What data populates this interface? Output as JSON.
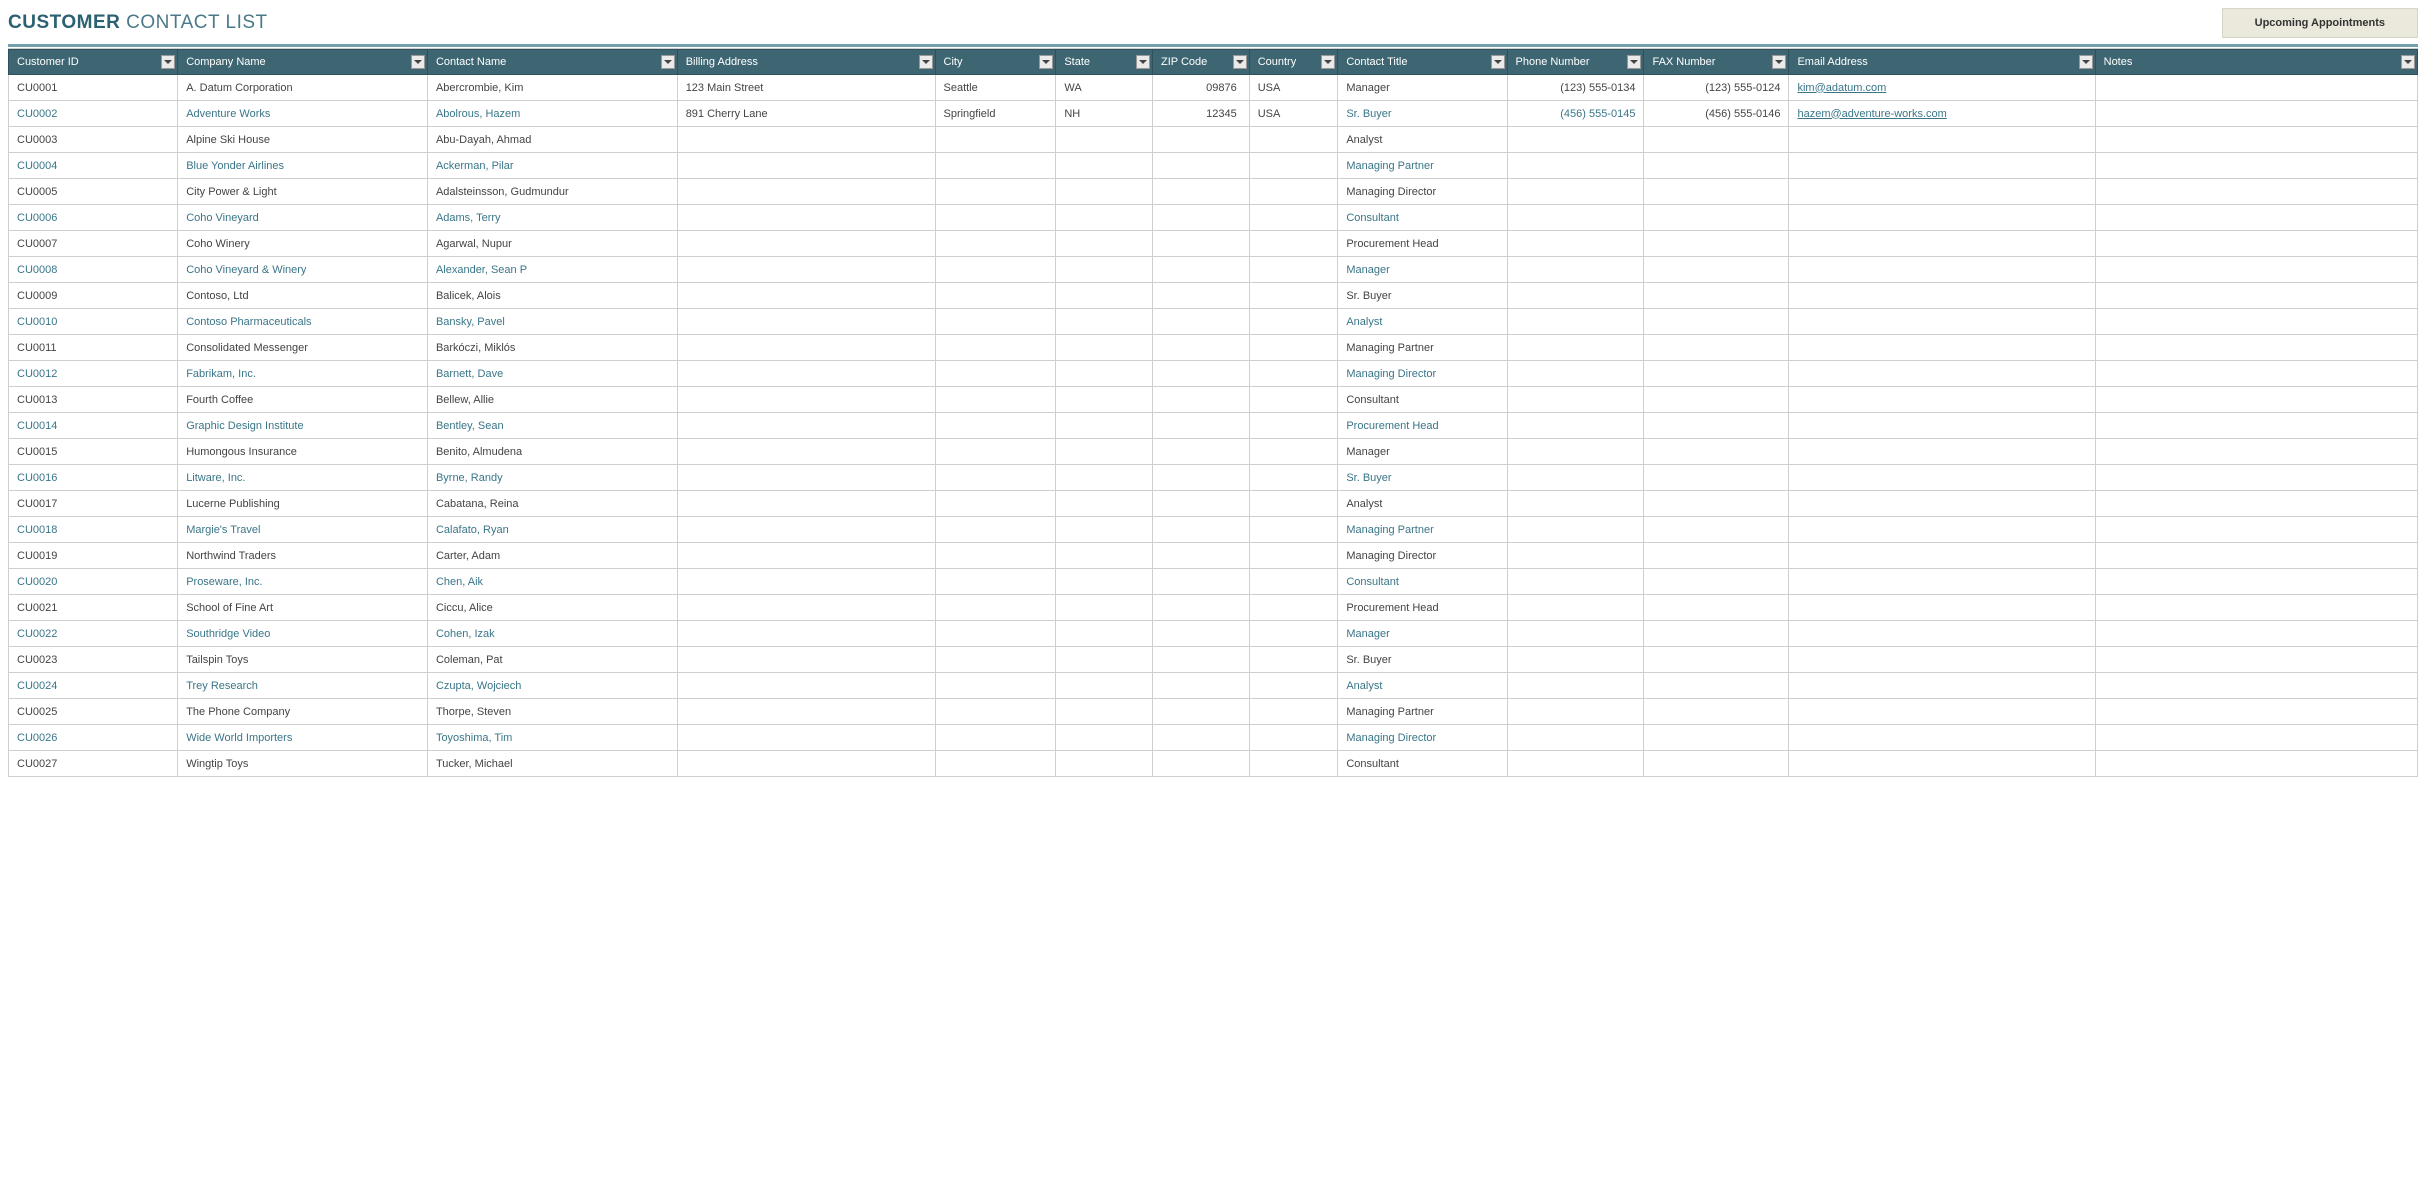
{
  "title": {
    "bold": "CUSTOMER",
    "rest": " CONTACT LIST"
  },
  "appointments_button": "Upcoming Appointments",
  "columns": [
    "Customer ID",
    "Company Name",
    "Contact Name",
    "Billing Address",
    "City",
    "State",
    "ZIP Code",
    "Country",
    "Contact Title",
    "Phone Number",
    "FAX Number",
    "Email Address",
    "Notes"
  ],
  "rows": [
    {
      "id": "CU0001",
      "company": "A. Datum Corporation",
      "contact": "Abercrombie, Kim",
      "billing": "123 Main Street",
      "city": "Seattle",
      "state": "WA",
      "zip": "09876",
      "country": "USA",
      "title": "Manager",
      "phone": "(123) 555-0134",
      "fax": "(123) 555-0124",
      "email": "kim@adatum.com",
      "notes": "",
      "linked": false
    },
    {
      "id": "CU0002",
      "company": "Adventure Works",
      "contact": "Abolrous, Hazem",
      "billing": "891 Cherry Lane",
      "city": "Springfield",
      "state": "NH",
      "zip": "12345",
      "country": "USA",
      "title": "Sr. Buyer",
      "phone": "(456) 555-0145",
      "fax": "(456) 555-0146",
      "email": "hazem@adventure-works.com",
      "notes": "",
      "linked": true
    },
    {
      "id": "CU0003",
      "company": "Alpine Ski House",
      "contact": "Abu-Dayah, Ahmad",
      "billing": "",
      "city": "",
      "state": "",
      "zip": "",
      "country": "",
      "title": "Analyst",
      "phone": "",
      "fax": "",
      "email": "",
      "notes": "",
      "linked": false
    },
    {
      "id": "CU0004",
      "company": "Blue Yonder Airlines",
      "contact": "Ackerman, Pilar",
      "billing": "",
      "city": "",
      "state": "",
      "zip": "",
      "country": "",
      "title": "Managing Partner",
      "phone": "",
      "fax": "",
      "email": "",
      "notes": "",
      "linked": true
    },
    {
      "id": "CU0005",
      "company": "City Power & Light",
      "contact": "Adalsteinsson, Gudmundur",
      "billing": "",
      "city": "",
      "state": "",
      "zip": "",
      "country": "",
      "title": "Managing Director",
      "phone": "",
      "fax": "",
      "email": "",
      "notes": "",
      "linked": false
    },
    {
      "id": "CU0006",
      "company": "Coho Vineyard",
      "contact": "Adams, Terry",
      "billing": "",
      "city": "",
      "state": "",
      "zip": "",
      "country": "",
      "title": "Consultant",
      "phone": "",
      "fax": "",
      "email": "",
      "notes": "",
      "linked": true
    },
    {
      "id": "CU0007",
      "company": "Coho Winery",
      "contact": "Agarwal, Nupur",
      "billing": "",
      "city": "",
      "state": "",
      "zip": "",
      "country": "",
      "title": "Procurement Head",
      "phone": "",
      "fax": "",
      "email": "",
      "notes": "",
      "linked": false
    },
    {
      "id": "CU0008",
      "company": "Coho Vineyard & Winery",
      "contact": "Alexander, Sean P",
      "billing": "",
      "city": "",
      "state": "",
      "zip": "",
      "country": "",
      "title": "Manager",
      "phone": "",
      "fax": "",
      "email": "",
      "notes": "",
      "linked": true
    },
    {
      "id": "CU0009",
      "company": "Contoso, Ltd",
      "contact": "Balicek, Alois",
      "billing": "",
      "city": "",
      "state": "",
      "zip": "",
      "country": "",
      "title": "Sr. Buyer",
      "phone": "",
      "fax": "",
      "email": "",
      "notes": "",
      "linked": false
    },
    {
      "id": "CU0010",
      "company": "Contoso Pharmaceuticals",
      "contact": "Bansky, Pavel",
      "billing": "",
      "city": "",
      "state": "",
      "zip": "",
      "country": "",
      "title": "Analyst",
      "phone": "",
      "fax": "",
      "email": "",
      "notes": "",
      "linked": true
    },
    {
      "id": "CU0011",
      "company": "Consolidated Messenger",
      "contact": "Barkóczi, Miklós",
      "billing": "",
      "city": "",
      "state": "",
      "zip": "",
      "country": "",
      "title": "Managing Partner",
      "phone": "",
      "fax": "",
      "email": "",
      "notes": "",
      "linked": false
    },
    {
      "id": "CU0012",
      "company": "Fabrikam, Inc.",
      "contact": "Barnett, Dave",
      "billing": "",
      "city": "",
      "state": "",
      "zip": "",
      "country": "",
      "title": "Managing Director",
      "phone": "",
      "fax": "",
      "email": "",
      "notes": "",
      "linked": true
    },
    {
      "id": "CU0013",
      "company": "Fourth Coffee",
      "contact": "Bellew, Allie",
      "billing": "",
      "city": "",
      "state": "",
      "zip": "",
      "country": "",
      "title": "Consultant",
      "phone": "",
      "fax": "",
      "email": "",
      "notes": "",
      "linked": false
    },
    {
      "id": "CU0014",
      "company": "Graphic Design Institute",
      "contact": "Bentley, Sean",
      "billing": "",
      "city": "",
      "state": "",
      "zip": "",
      "country": "",
      "title": "Procurement Head",
      "phone": "",
      "fax": "",
      "email": "",
      "notes": "",
      "linked": true
    },
    {
      "id": "CU0015",
      "company": "Humongous Insurance",
      "contact": "Benito, Almudena",
      "billing": "",
      "city": "",
      "state": "",
      "zip": "",
      "country": "",
      "title": "Manager",
      "phone": "",
      "fax": "",
      "email": "",
      "notes": "",
      "linked": false
    },
    {
      "id": "CU0016",
      "company": "Litware, Inc.",
      "contact": "Byrne, Randy",
      "billing": "",
      "city": "",
      "state": "",
      "zip": "",
      "country": "",
      "title": "Sr. Buyer",
      "phone": "",
      "fax": "",
      "email": "",
      "notes": "",
      "linked": true
    },
    {
      "id": "CU0017",
      "company": "Lucerne Publishing",
      "contact": "Cabatana, Reina",
      "billing": "",
      "city": "",
      "state": "",
      "zip": "",
      "country": "",
      "title": "Analyst",
      "phone": "",
      "fax": "",
      "email": "",
      "notes": "",
      "linked": false
    },
    {
      "id": "CU0018",
      "company": "Margie's Travel",
      "contact": "Calafato, Ryan",
      "billing": "",
      "city": "",
      "state": "",
      "zip": "",
      "country": "",
      "title": "Managing Partner",
      "phone": "",
      "fax": "",
      "email": "",
      "notes": "",
      "linked": true
    },
    {
      "id": "CU0019",
      "company": "Northwind Traders",
      "contact": "Carter, Adam",
      "billing": "",
      "city": "",
      "state": "",
      "zip": "",
      "country": "",
      "title": "Managing Director",
      "phone": "",
      "fax": "",
      "email": "",
      "notes": "",
      "linked": false
    },
    {
      "id": "CU0020",
      "company": "Proseware, Inc.",
      "contact": "Chen, Aik",
      "billing": "",
      "city": "",
      "state": "",
      "zip": "",
      "country": "",
      "title": "Consultant",
      "phone": "",
      "fax": "",
      "email": "",
      "notes": "",
      "linked": true
    },
    {
      "id": "CU0021",
      "company": "School of Fine Art",
      "contact": "Ciccu, Alice",
      "billing": "",
      "city": "",
      "state": "",
      "zip": "",
      "country": "",
      "title": "Procurement Head",
      "phone": "",
      "fax": "",
      "email": "",
      "notes": "",
      "linked": false
    },
    {
      "id": "CU0022",
      "company": "Southridge Video",
      "contact": "Cohen, Izak",
      "billing": "",
      "city": "",
      "state": "",
      "zip": "",
      "country": "",
      "title": "Manager",
      "phone": "",
      "fax": "",
      "email": "",
      "notes": "",
      "linked": true
    },
    {
      "id": "CU0023",
      "company": "Tailspin Toys",
      "contact": "Coleman, Pat",
      "billing": "",
      "city": "",
      "state": "",
      "zip": "",
      "country": "",
      "title": "Sr. Buyer",
      "phone": "",
      "fax": "",
      "email": "",
      "notes": "",
      "linked": false
    },
    {
      "id": "CU0024",
      "company": "Trey Research",
      "contact": "Czupta, Wojciech",
      "billing": "",
      "city": "",
      "state": "",
      "zip": "",
      "country": "",
      "title": "Analyst",
      "phone": "",
      "fax": "",
      "email": "",
      "notes": "",
      "linked": true
    },
    {
      "id": "CU0025",
      "company": "The Phone Company",
      "contact": "Thorpe, Steven",
      "billing": "",
      "city": "",
      "state": "",
      "zip": "",
      "country": "",
      "title": "Managing Partner",
      "phone": "",
      "fax": "",
      "email": "",
      "notes": "",
      "linked": false
    },
    {
      "id": "CU0026",
      "company": "Wide World Importers",
      "contact": "Toyoshima, Tim",
      "billing": "",
      "city": "",
      "state": "",
      "zip": "",
      "country": "",
      "title": "Managing Director",
      "phone": "",
      "fax": "",
      "email": "",
      "notes": "",
      "linked": true
    },
    {
      "id": "CU0027",
      "company": "Wingtip Toys",
      "contact": "Tucker, Michael",
      "billing": "",
      "city": "",
      "state": "",
      "zip": "",
      "country": "",
      "title": "Consultant",
      "phone": "",
      "fax": "",
      "email": "",
      "notes": "",
      "linked": false
    }
  ]
}
